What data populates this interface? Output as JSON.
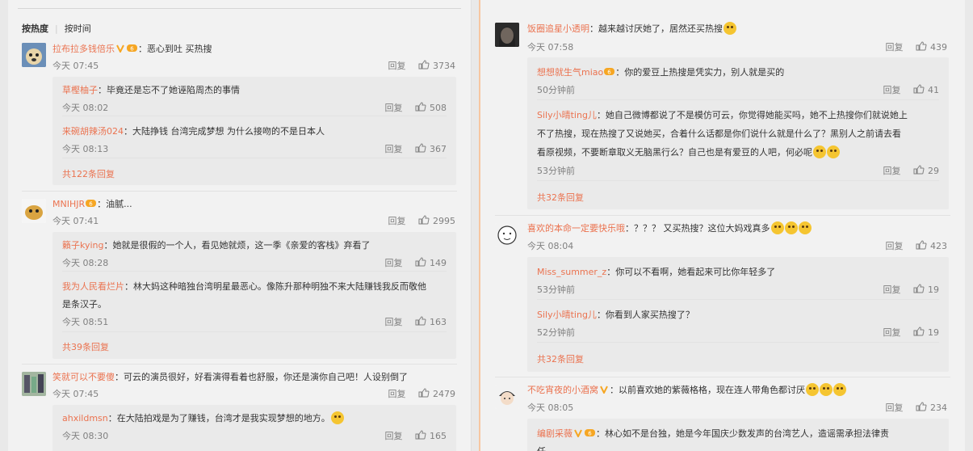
{
  "left": {
    "sort_hot": "按热度",
    "sort_time": "按时间",
    "c1": {
      "user": "拉布拉多钱倍乐",
      "text": "：恶心到吐 买热搜",
      "time": "今天 07:45",
      "reply": "回复",
      "likes": "3734"
    },
    "c1r1": {
      "user": "草樫柚子",
      "text": "：毕竟还是忘不了她诬陷周杰的事情",
      "time": "今天 08:02",
      "reply": "回复",
      "likes": "508"
    },
    "c1r2": {
      "user": "来碗胡辣汤024",
      "text": "：大陆挣钱 台湾完成梦想 为什么接吻的不是日本人",
      "time": "今天 08:13",
      "reply": "回复",
      "likes": "367"
    },
    "c1more": "共122条回复",
    "c2": {
      "user": "MNIHJR",
      "text": "：油腻...",
      "time": "今天 07:41",
      "reply": "回复",
      "likes": "2995"
    },
    "c2r1": {
      "user": "籟子kying",
      "text": "：她就是很假的一个人，看见她就烦，这一季《亲爱的客栈》弃看了",
      "time": "今天 08:28",
      "reply": "回复",
      "likes": "149"
    },
    "c2r2": {
      "user": "我为人民看烂片",
      "text": "：林大妈这种暗独台湾明星最恶心。像陈升那种明独不来大陆赚钱我反而敬他",
      "text2": "是条汉子。",
      "time": "今天 08:51",
      "reply": "回复",
      "likes": "163"
    },
    "c2more": "共39条回复",
    "c3": {
      "user": "笑就可以不要傻",
      "text": "：可云的演员很好，好看演得看着也舒服，你还是演你自己吧！人设别倒了",
      "time": "今天 07:45",
      "reply": "回复",
      "likes": "2479"
    },
    "c3r1": {
      "user": "ahxildmsn",
      "text": "：在大陆拍戏是为了赚钱，台湾才是我实现梦想的地方。",
      "time": "今天 08:30",
      "reply": "回复",
      "likes": "165"
    }
  },
  "right": {
    "c1": {
      "user": "饭圈追星小透明",
      "text": "：越来越讨厌她了，居然还买热搜",
      "time": "今天 07:58",
      "reply": "回复",
      "likes": "439"
    },
    "c1r1": {
      "user": "想想就生气miao",
      "text": "：你的爱豆上热搜是凭实力，别人就是买的",
      "time": "50分钟前",
      "reply": "回复",
      "likes": "41"
    },
    "c1r2": {
      "user": "Sily小晴ting儿",
      "text": "：她自己微博都说了不是模仿可云，你觉得她能买吗，她不上热搜你们就说她上",
      "text2": "不了热搜，现在热搜了又说她买，合着什么话都是你们说什么就是什么了？黑别人之前请去看",
      "text3": "看原视频，不要断章取义无脑黑行么？自己也是有爱豆的人吧，何必呢",
      "time": "53分钟前",
      "reply": "回复",
      "likes": "29"
    },
    "c1more": "共32条回复",
    "c2": {
      "user": "喜欢的本命一定要快乐哦",
      "text": "：？？？ 又买热搜？这位大妈戏真多",
      "time": "今天 08:04",
      "reply": "回复",
      "likes": "423"
    },
    "c2r1": {
      "user": "Miss_summer_z",
      "text": "：你可以不看啊，她看起来可比你年轻多了",
      "time": "53分钟前",
      "reply": "回复",
      "likes": "19"
    },
    "c2r2": {
      "user": "Sily小晴ting儿",
      "text": "：你看到人家买热搜了？",
      "time": "52分钟前",
      "reply": "回复",
      "likes": "19"
    },
    "c2more": "共32条回复",
    "c3": {
      "user": "不吃宵夜的小酒窝",
      "text": "：以前喜欢她的紫薇格格，现在连人带角色都讨厌",
      "time": "今天 08:05",
      "reply": "回复",
      "likes": "234"
    },
    "c3r1": {
      "user": "编剧采薇",
      "text": "：林心如不是台独，她是今年国庆少数发声的台湾艺人，造谣需承担法律责",
      "text2": "任"
    }
  },
  "colors": {
    "name": "#eb7350",
    "muted": "#808080",
    "badge": "#f6a623"
  },
  "icons": [
    "like-icon",
    "vip-badge-icon",
    "verified-v-icon",
    "emoji-icon"
  ]
}
